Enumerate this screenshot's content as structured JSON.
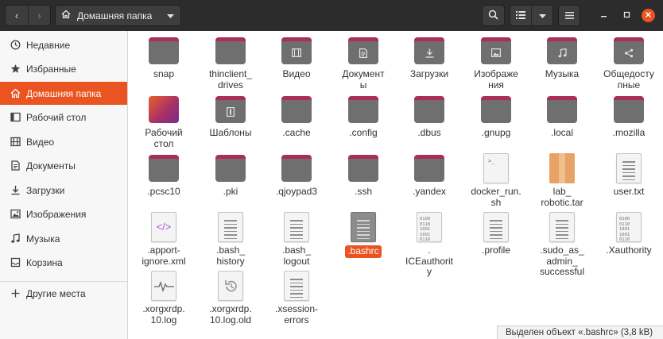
{
  "header": {
    "path_label": "Домашняя папка",
    "icons": {
      "back": "chevron-left-icon",
      "forward": "chevron-right-icon",
      "home": "home-icon",
      "search": "search-icon",
      "list_view": "list-view-icon",
      "view_options": "chevron-down-icon",
      "menu": "hamburger-menu-icon",
      "minimize": "minimize-icon",
      "maximize": "maximize-icon",
      "close": "close-icon"
    }
  },
  "sidebar": {
    "items": [
      {
        "label": "Недавние",
        "icon": "clock-icon"
      },
      {
        "label": "Избранные",
        "icon": "star-icon"
      },
      {
        "label": "Домашняя папка",
        "icon": "home-icon",
        "active": true
      },
      {
        "label": "Рабочий стол",
        "icon": "desktop-icon"
      },
      {
        "label": "Видео",
        "icon": "video-icon"
      },
      {
        "label": "Документы",
        "icon": "document-icon"
      },
      {
        "label": "Загрузки",
        "icon": "download-icon"
      },
      {
        "label": "Изображения",
        "icon": "image-icon"
      },
      {
        "label": "Музыка",
        "icon": "music-icon"
      },
      {
        "label": "Корзина",
        "icon": "trash-icon"
      }
    ],
    "other_places": {
      "label": "Другие места",
      "icon": "plus-icon"
    }
  },
  "files": [
    {
      "label": "snap",
      "type": "folder"
    },
    {
      "label": "thinclient_\ndrives",
      "type": "folder"
    },
    {
      "label": "Видео",
      "type": "folder",
      "emblem": "video-icon"
    },
    {
      "label": "Документ\nы",
      "type": "folder",
      "emblem": "document-icon"
    },
    {
      "label": "Загрузки",
      "type": "folder",
      "emblem": "download-icon"
    },
    {
      "label": "Изображе\nния",
      "type": "folder",
      "emblem": "image-icon"
    },
    {
      "label": "Музыка",
      "type": "folder",
      "emblem": "music-icon"
    },
    {
      "label": "Общедосту\nпные",
      "type": "folder",
      "emblem": "share-icon"
    },
    {
      "label": "Рабочий\nстол",
      "type": "desktop-folder"
    },
    {
      "label": "Шаблоны",
      "type": "folder",
      "emblem": "template-icon"
    },
    {
      "label": ".cache",
      "type": "folder"
    },
    {
      "label": ".config",
      "type": "folder"
    },
    {
      "label": ".dbus",
      "type": "folder"
    },
    {
      "label": ".gnupg",
      "type": "folder"
    },
    {
      "label": ".local",
      "type": "folder"
    },
    {
      "label": ".mozilla",
      "type": "folder"
    },
    {
      "label": ".pcsc10",
      "type": "folder"
    },
    {
      "label": ".pki",
      "type": "folder"
    },
    {
      "label": ".qjoypad3",
      "type": "folder"
    },
    {
      "label": ".ssh",
      "type": "folder"
    },
    {
      "label": ".yandex",
      "type": "folder"
    },
    {
      "label": "docker_run.\nsh",
      "type": "script"
    },
    {
      "label": "lab_\nrobotic.tar",
      "type": "archive"
    },
    {
      "label": "user.txt",
      "type": "text"
    },
    {
      "label": ".apport-\nignore.xml",
      "type": "xml"
    },
    {
      "label": ".bash_\nhistory",
      "type": "text"
    },
    {
      "label": ".bash_\nlogout",
      "type": "text"
    },
    {
      "label": ".bashrc",
      "type": "text",
      "selected": true
    },
    {
      "label": ".\nICEauthorit\ny",
      "type": "binary"
    },
    {
      "label": ".profile",
      "type": "text"
    },
    {
      "label": ".sudo_as_\nadmin_\nsuccessful",
      "type": "text"
    },
    {
      "label": ".Xauthority",
      "type": "binary"
    },
    {
      "label": ".xorgxrdp.\n10.log",
      "type": "log"
    },
    {
      "label": ".xorgxrdp.\n10.log.old",
      "type": "backup"
    },
    {
      "label": ".xsession-\nerrors",
      "type": "text"
    }
  ],
  "status": {
    "text": "Выделен объект «.bashrc» (3,8 kB)"
  },
  "colors": {
    "accent": "#e95420",
    "folder_tab": "#aa2f57",
    "folder_body": "#6f6f6f",
    "header": "#2c2c2c"
  }
}
